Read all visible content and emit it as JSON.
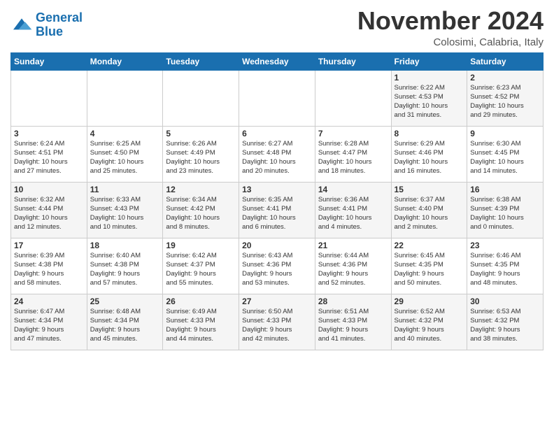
{
  "logo": {
    "line1": "General",
    "line2": "Blue"
  },
  "title": "November 2024",
  "subtitle": "Colosimi, Calabria, Italy",
  "weekdays": [
    "Sunday",
    "Monday",
    "Tuesday",
    "Wednesday",
    "Thursday",
    "Friday",
    "Saturday"
  ],
  "weeks": [
    [
      {
        "day": "",
        "info": ""
      },
      {
        "day": "",
        "info": ""
      },
      {
        "day": "",
        "info": ""
      },
      {
        "day": "",
        "info": ""
      },
      {
        "day": "",
        "info": ""
      },
      {
        "day": "1",
        "info": "Sunrise: 6:22 AM\nSunset: 4:53 PM\nDaylight: 10 hours\nand 31 minutes."
      },
      {
        "day": "2",
        "info": "Sunrise: 6:23 AM\nSunset: 4:52 PM\nDaylight: 10 hours\nand 29 minutes."
      }
    ],
    [
      {
        "day": "3",
        "info": "Sunrise: 6:24 AM\nSunset: 4:51 PM\nDaylight: 10 hours\nand 27 minutes."
      },
      {
        "day": "4",
        "info": "Sunrise: 6:25 AM\nSunset: 4:50 PM\nDaylight: 10 hours\nand 25 minutes."
      },
      {
        "day": "5",
        "info": "Sunrise: 6:26 AM\nSunset: 4:49 PM\nDaylight: 10 hours\nand 23 minutes."
      },
      {
        "day": "6",
        "info": "Sunrise: 6:27 AM\nSunset: 4:48 PM\nDaylight: 10 hours\nand 20 minutes."
      },
      {
        "day": "7",
        "info": "Sunrise: 6:28 AM\nSunset: 4:47 PM\nDaylight: 10 hours\nand 18 minutes."
      },
      {
        "day": "8",
        "info": "Sunrise: 6:29 AM\nSunset: 4:46 PM\nDaylight: 10 hours\nand 16 minutes."
      },
      {
        "day": "9",
        "info": "Sunrise: 6:30 AM\nSunset: 4:45 PM\nDaylight: 10 hours\nand 14 minutes."
      }
    ],
    [
      {
        "day": "10",
        "info": "Sunrise: 6:32 AM\nSunset: 4:44 PM\nDaylight: 10 hours\nand 12 minutes."
      },
      {
        "day": "11",
        "info": "Sunrise: 6:33 AM\nSunset: 4:43 PM\nDaylight: 10 hours\nand 10 minutes."
      },
      {
        "day": "12",
        "info": "Sunrise: 6:34 AM\nSunset: 4:42 PM\nDaylight: 10 hours\nand 8 minutes."
      },
      {
        "day": "13",
        "info": "Sunrise: 6:35 AM\nSunset: 4:41 PM\nDaylight: 10 hours\nand 6 minutes."
      },
      {
        "day": "14",
        "info": "Sunrise: 6:36 AM\nSunset: 4:41 PM\nDaylight: 10 hours\nand 4 minutes."
      },
      {
        "day": "15",
        "info": "Sunrise: 6:37 AM\nSunset: 4:40 PM\nDaylight: 10 hours\nand 2 minutes."
      },
      {
        "day": "16",
        "info": "Sunrise: 6:38 AM\nSunset: 4:39 PM\nDaylight: 10 hours\nand 0 minutes."
      }
    ],
    [
      {
        "day": "17",
        "info": "Sunrise: 6:39 AM\nSunset: 4:38 PM\nDaylight: 9 hours\nand 58 minutes."
      },
      {
        "day": "18",
        "info": "Sunrise: 6:40 AM\nSunset: 4:38 PM\nDaylight: 9 hours\nand 57 minutes."
      },
      {
        "day": "19",
        "info": "Sunrise: 6:42 AM\nSunset: 4:37 PM\nDaylight: 9 hours\nand 55 minutes."
      },
      {
        "day": "20",
        "info": "Sunrise: 6:43 AM\nSunset: 4:36 PM\nDaylight: 9 hours\nand 53 minutes."
      },
      {
        "day": "21",
        "info": "Sunrise: 6:44 AM\nSunset: 4:36 PM\nDaylight: 9 hours\nand 52 minutes."
      },
      {
        "day": "22",
        "info": "Sunrise: 6:45 AM\nSunset: 4:35 PM\nDaylight: 9 hours\nand 50 minutes."
      },
      {
        "day": "23",
        "info": "Sunrise: 6:46 AM\nSunset: 4:35 PM\nDaylight: 9 hours\nand 48 minutes."
      }
    ],
    [
      {
        "day": "24",
        "info": "Sunrise: 6:47 AM\nSunset: 4:34 PM\nDaylight: 9 hours\nand 47 minutes."
      },
      {
        "day": "25",
        "info": "Sunrise: 6:48 AM\nSunset: 4:34 PM\nDaylight: 9 hours\nand 45 minutes."
      },
      {
        "day": "26",
        "info": "Sunrise: 6:49 AM\nSunset: 4:33 PM\nDaylight: 9 hours\nand 44 minutes."
      },
      {
        "day": "27",
        "info": "Sunrise: 6:50 AM\nSunset: 4:33 PM\nDaylight: 9 hours\nand 42 minutes."
      },
      {
        "day": "28",
        "info": "Sunrise: 6:51 AM\nSunset: 4:33 PM\nDaylight: 9 hours\nand 41 minutes."
      },
      {
        "day": "29",
        "info": "Sunrise: 6:52 AM\nSunset: 4:32 PM\nDaylight: 9 hours\nand 40 minutes."
      },
      {
        "day": "30",
        "info": "Sunrise: 6:53 AM\nSunset: 4:32 PM\nDaylight: 9 hours\nand 38 minutes."
      }
    ]
  ]
}
